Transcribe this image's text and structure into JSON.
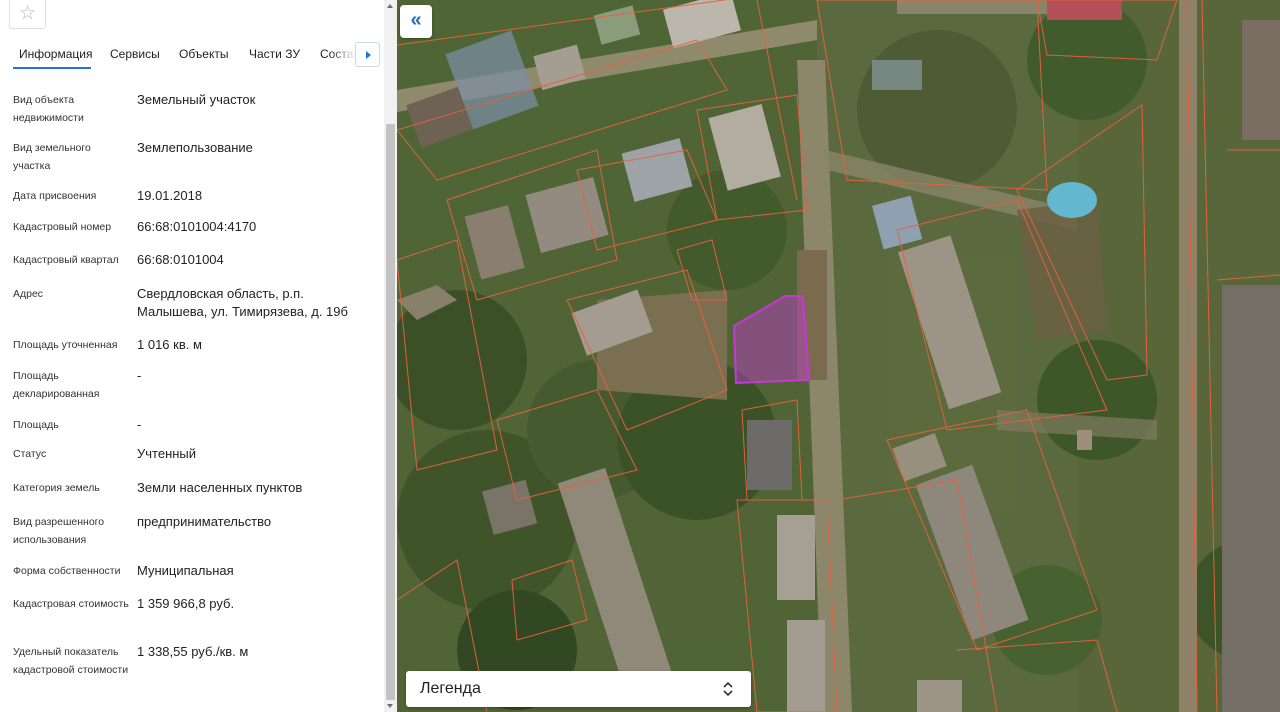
{
  "panel": {
    "favorite_icon": "star-outline-icon",
    "tabs": [
      {
        "label": "Информация",
        "active": true
      },
      {
        "label": "Сервисы",
        "active": false
      },
      {
        "label": "Объекты",
        "active": false
      },
      {
        "label": "Части ЗУ",
        "active": false
      },
      {
        "label": "Состав",
        "active": false
      }
    ],
    "tabs_next_icon": "triangle-right-icon",
    "fields": [
      {
        "label": "Вид объекта недвижимости",
        "value": "Земельный участок"
      },
      {
        "label": "Вид земельного участка",
        "value": "Землепользование"
      },
      {
        "label": "Дата присвоения",
        "value": "19.01.2018"
      },
      {
        "label": "Кадастровый номер",
        "value": "66:68:0101004:4170"
      },
      {
        "label": "Кадастровый квартал",
        "value": "66:68:0101004"
      },
      {
        "label": "Адрес",
        "value": "Свердловская область, р.п. Малышева, ул. Тимирязева, д. 19б"
      },
      {
        "label": "Площадь уточненная",
        "value": "1 016 кв. м"
      },
      {
        "label": "Площадь декларированная",
        "value": "-"
      },
      {
        "label": "Площадь",
        "value": "-"
      },
      {
        "label": "Статус",
        "value": "Учтенный"
      },
      {
        "label": "Категория земель",
        "value": "Земли населенных пунктов"
      },
      {
        "label": "Вид разрешенного использования",
        "value": "предпринимательство"
      },
      {
        "label": "Форма собственности",
        "value": "Муниципальная"
      },
      {
        "label": "Кадастровая стоимость",
        "value": "1 359 966,8 руб."
      },
      {
        "label": "Удельный показатель кадастровой стоимости",
        "value": "1 338,55 руб./кв. м"
      }
    ]
  },
  "map": {
    "collapse_icon": "double-chevron-left-icon",
    "legend_label": "Легенда",
    "legend_icon": "chevron-up-down-icon",
    "colors": {
      "parcel_border": "#e8613c",
      "selected_parcel": "#c23ad0",
      "accent": "#1a7ad4"
    }
  }
}
